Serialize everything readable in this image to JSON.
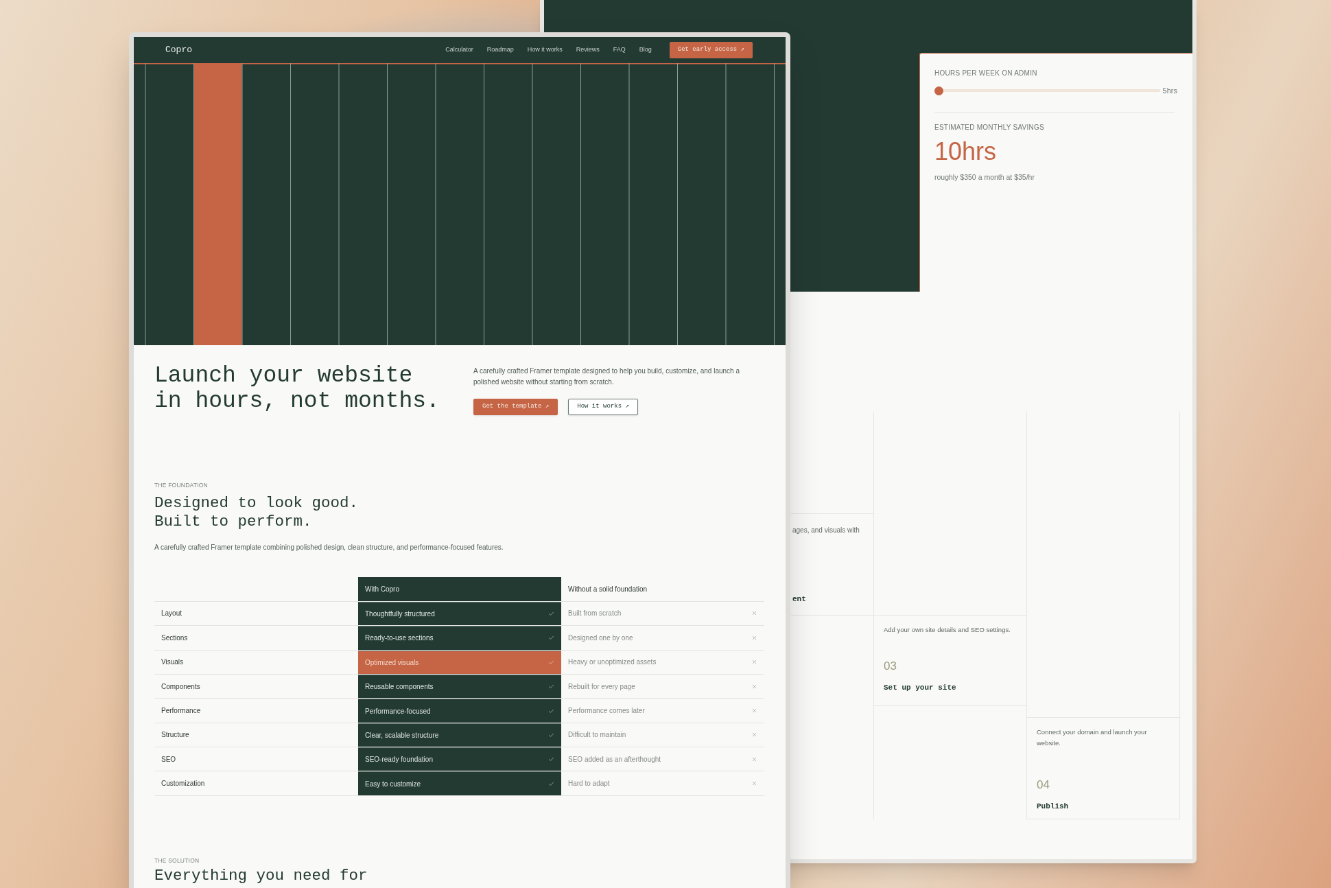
{
  "front_page": {
    "nav": {
      "logo": "Copro",
      "links": [
        "Calculator",
        "Roadmap",
        "How it works",
        "Reviews",
        "FAQ",
        "Blog"
      ],
      "cta": "Get early access ↗"
    },
    "hero": {
      "heading_lines": [
        "Launch your website",
        "in hours, not months."
      ],
      "description": "A carefully crafted Framer template designed to help you build, customize, and launch a polished website without starting from scratch.",
      "buttons": [
        {
          "label": "Get the template ↗",
          "kind": "primary"
        },
        {
          "label": "How it works ↗",
          "kind": "outline"
        }
      ]
    },
    "foundation": {
      "eyebrow": "THE FOUNDATION",
      "heading_lines": [
        "Designed to look good.",
        "Built to perform."
      ],
      "description": "A carefully crafted Framer template combining polished design, clean structure, and performance-focused features."
    },
    "comparison": {
      "columns": [
        "With Copro",
        "Without a solid foundation"
      ],
      "rows": [
        {
          "label": "Layout",
          "with": "Thoughtfully structured",
          "without": "Built from scratch",
          "highlighted": false
        },
        {
          "label": "Sections",
          "with": "Ready-to-use sections",
          "without": "Designed one by one",
          "highlighted": false
        },
        {
          "label": "Visuals",
          "with": "Optimized visuals",
          "without": "Heavy or unoptimized assets",
          "highlighted": true
        },
        {
          "label": "Components",
          "with": "Reusable components",
          "without": "Rebuilt for every page",
          "highlighted": false
        },
        {
          "label": "Performance",
          "with": "Performance-focused",
          "without": "Performance comes later",
          "highlighted": false
        },
        {
          "label": "Structure",
          "with": "Clear, scalable structure",
          "without": "Difficult to maintain",
          "highlighted": false
        },
        {
          "label": "SEO",
          "with": "SEO-ready foundation",
          "without": "SEO added as an afterthought",
          "highlighted": false
        },
        {
          "label": "Customization",
          "with": "Easy to customize",
          "without": "Hard to adapt",
          "highlighted": false
        }
      ]
    },
    "solution": {
      "eyebrow": "THE SOLUTION",
      "heading": "Everything you need for"
    }
  },
  "back_page": {
    "calculator": {
      "label": "HOURS PER WEEK ON ADMIN",
      "slider": {
        "level": 0
      },
      "reading": "5hrs",
      "savings_label": "ESTIMATED MONTHLY SAVINGS",
      "savings": "10hrs",
      "note": "roughly $350 a month at $35/hr"
    },
    "steps": [
      {
        "text": "ages, and visuals with",
        "title": "ent"
      },
      {
        "text": "Add your own site details and SEO settings.",
        "number": "03",
        "title": "Set up your site"
      },
      {
        "text": "Connect your domain and launch your website.",
        "number": "04",
        "title": "Publish"
      }
    ]
  }
}
